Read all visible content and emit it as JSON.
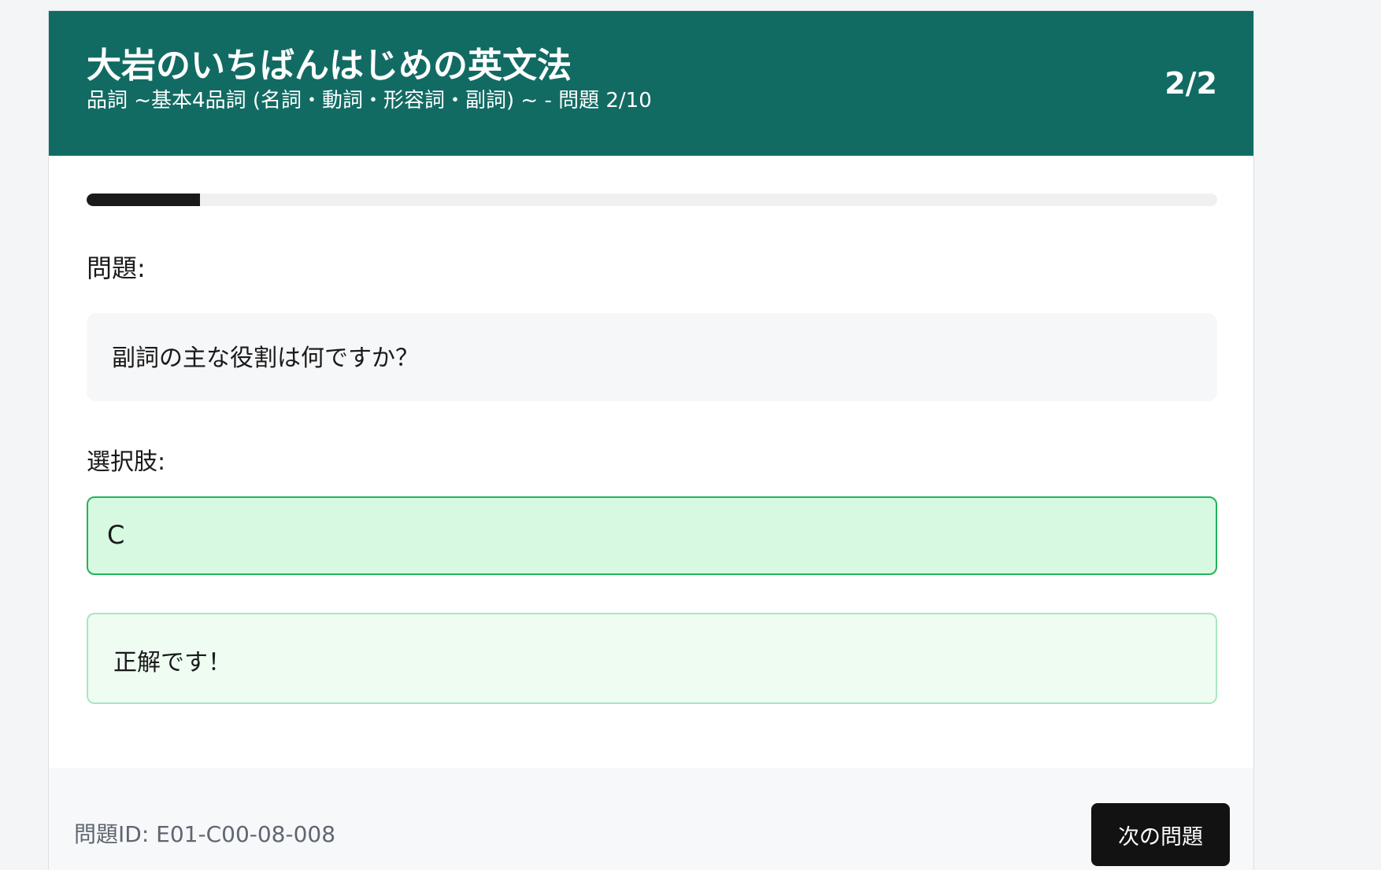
{
  "header": {
    "title": "大岩のいちばんはじめの英文法",
    "subtitle": "品詞 ~基本4品詞 (名詞・動詞・形容詞・副詞) ~ - 問題 2/10",
    "counter": "2/2",
    "background_color": "#126b63"
  },
  "progress": {
    "fraction": 0.1,
    "fill_color": "#1a1a1a"
  },
  "question": {
    "label": "問題:",
    "text": "副詞の主な役割は何ですか？"
  },
  "choices": {
    "label": "選択肢:",
    "items": [
      {
        "label": "C",
        "state": "correct",
        "color": "#22b55b"
      }
    ]
  },
  "feedback": {
    "text": "正解です！",
    "color": "#eefcf2"
  },
  "footer": {
    "question_id": "問題ID: E01-C00-08-008",
    "next_button_label": "次の問題"
  }
}
